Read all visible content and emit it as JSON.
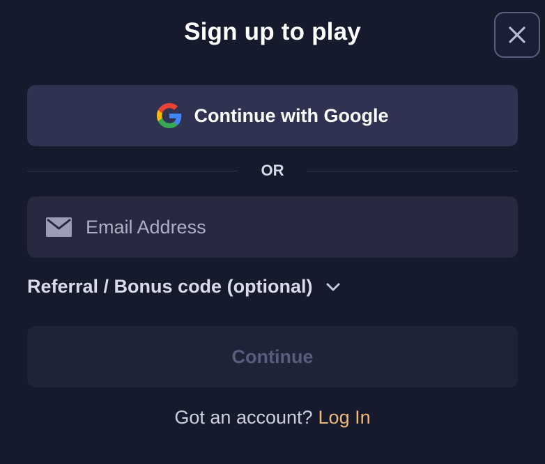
{
  "modal": {
    "title": "Sign up to play"
  },
  "google_button": {
    "label": "Continue with Google",
    "icon": "google-logo-icon"
  },
  "divider": {
    "text": "OR"
  },
  "email_field": {
    "placeholder": "Email Address",
    "value": "",
    "icon": "mail-icon"
  },
  "referral": {
    "label": "Referral / Bonus code (optional)",
    "icon": "chevron-down-icon"
  },
  "continue_button": {
    "label": "Continue",
    "state": "disabled"
  },
  "footer": {
    "prompt": "Got an account?",
    "login_link": "Log In"
  },
  "colors": {
    "background": "#161a2d",
    "google_button_bg": "#2f3250",
    "input_bg": "#262940",
    "continue_disabled_bg": "#1f2337",
    "continue_disabled_text": "#585d7c",
    "link_accent": "#f0b87a",
    "close_border": "#5b6080"
  }
}
